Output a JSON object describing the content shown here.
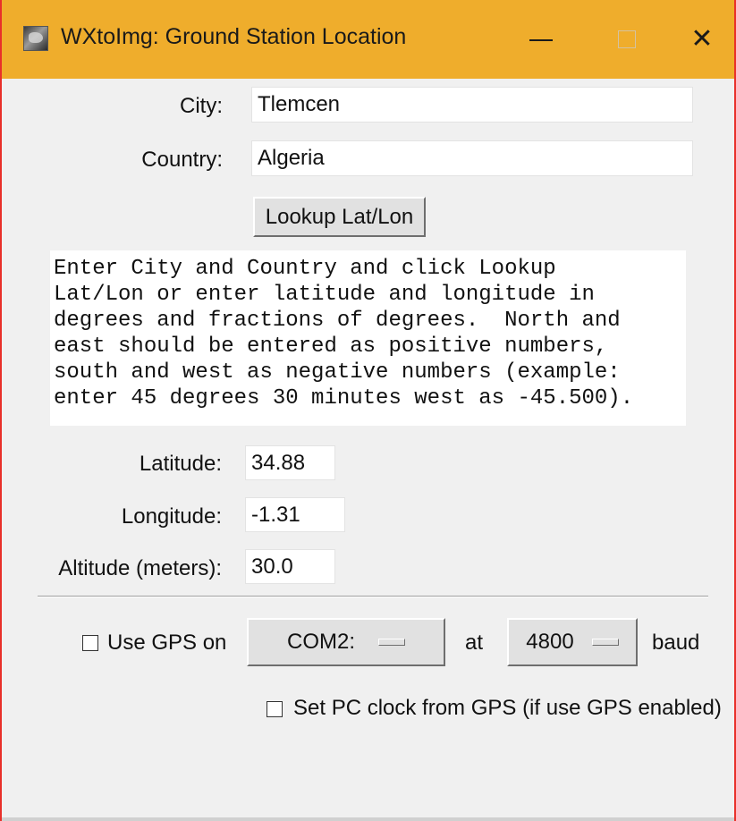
{
  "window": {
    "title": "WXtoImg: Ground Station Location"
  },
  "titlebar_buttons": {
    "minimize": "minimize",
    "maximize": "maximize",
    "close": "close"
  },
  "form": {
    "city_label": "City:",
    "city_value": "Tlemcen",
    "country_label": "Country:",
    "country_value": "Algeria",
    "lookup_button": "Lookup Lat/Lon",
    "instructions": "Enter City and Country and click Lookup\nLat/Lon or enter latitude and longitude in\ndegrees and fractions of degrees.  North and\neast should be entered as positive numbers,\nsouth and west as negative numbers (example:\nenter 45 degrees 30 minutes west as -45.500).",
    "latitude_label": "Latitude:",
    "latitude_value": "34.88",
    "longitude_label": "Longitude:",
    "longitude_value": "-1.31",
    "altitude_label": "Altitude (meters):",
    "altitude_value": "30.0"
  },
  "gps": {
    "use_gps_label": "Use GPS on",
    "use_gps_checked": false,
    "port_value": "COM2:",
    "at_label": "at",
    "baud_value": "4800",
    "baud_label": "baud",
    "set_clock_label": "Set PC clock from GPS (if use GPS enabled)",
    "set_clock_checked": false
  },
  "colors": {
    "titlebar": "#efad2c",
    "window_border": "#e8302a",
    "background": "#f0f0f0"
  }
}
